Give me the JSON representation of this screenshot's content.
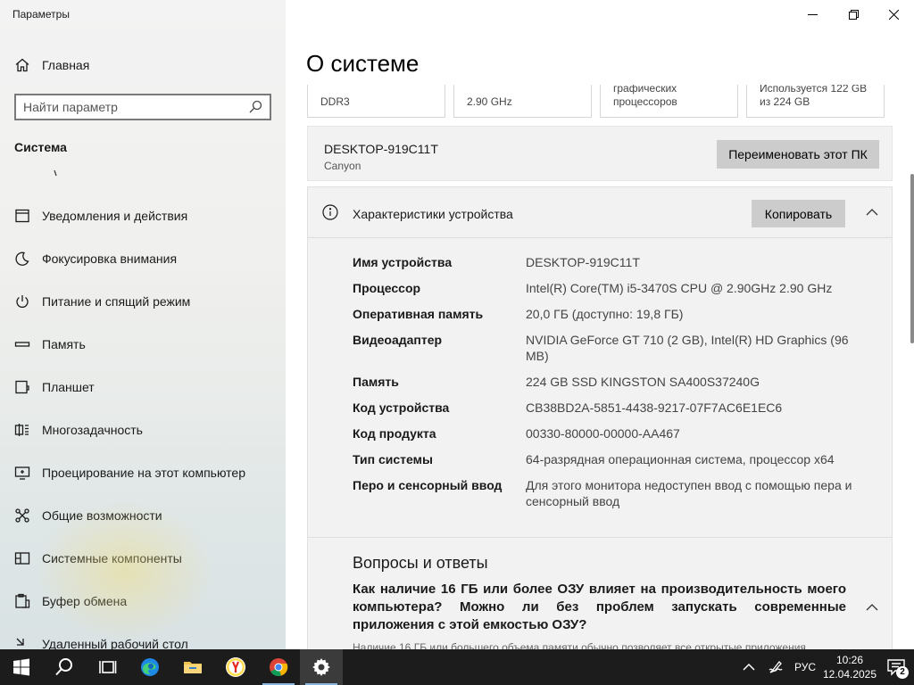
{
  "window": {
    "app_title": "Параметры"
  },
  "sidebar": {
    "home_label": "Главная",
    "search_placeholder": "Найти параметр",
    "section_title": "Система",
    "items": [
      {
        "label": "Уведомления и действия",
        "icon": "notification-icon"
      },
      {
        "label": "Фокусировка внимания",
        "icon": "moon-icon"
      },
      {
        "label": "Питание и спящий режим",
        "icon": "power-icon"
      },
      {
        "label": "Память",
        "icon": "storage-icon"
      },
      {
        "label": "Планшет",
        "icon": "tablet-icon"
      },
      {
        "label": "Многозадачность",
        "icon": "multitasking-icon"
      },
      {
        "label": "Проецирование на этот компьютер",
        "icon": "projection-icon"
      },
      {
        "label": "Общие возможности",
        "icon": "shared-experiences-icon"
      },
      {
        "label": "Системные компоненты",
        "icon": "system-components-icon"
      },
      {
        "label": "Буфер обмена",
        "icon": "clipboard-icon"
      },
      {
        "label": "Удаленный рабочий стол",
        "icon": "remote-desktop-icon"
      }
    ]
  },
  "main": {
    "page_title": "О системе",
    "spec_cards": [
      {
        "text": "DDR3"
      },
      {
        "text": "2.90 GHz"
      },
      {
        "text": "графических процессоров"
      },
      {
        "text": "Используется 122 GB из 224 GB"
      }
    ],
    "pc": {
      "name": "DESKTOP-919C11T",
      "subtitle": "Canyon",
      "rename_label": "Переименовать этот ПК"
    },
    "device_specs": {
      "title": "Характеристики устройства",
      "copy_label": "Копировать",
      "rows": [
        {
          "key": "Имя устройства",
          "value": "DESKTOP-919C11T"
        },
        {
          "key": "Процессор",
          "value": "Intel(R) Core(TM) i5-3470S CPU @ 2.90GHz   2.90 GHz"
        },
        {
          "key": "Оперативная память",
          "value": "20,0 ГБ (доступно: 19,8 ГБ)"
        },
        {
          "key": "Видеоадаптер",
          "value": "NVIDIA GeForce GT 710 (2 GB), Intel(R) HD Graphics (96 MB)"
        },
        {
          "key": "Память",
          "value": "224 GB SSD KINGSTON SA400S37240G"
        },
        {
          "key": "Код устройства",
          "value": "CB38BD2A-5851-4438-9217-07F7AC6E1EC6"
        },
        {
          "key": "Код продукта",
          "value": "00330-80000-00000-AA467"
        },
        {
          "key": "Тип системы",
          "value": "64-разрядная операционная система, процессор x64"
        },
        {
          "key": "Перо и сенсорный ввод",
          "value": "Для этого монитора недоступен ввод с помощью пера и сенсорный ввод"
        }
      ]
    },
    "faq": {
      "title": "Вопросы и ответы",
      "question": "Как наличие 16 ГБ или более ОЗУ влияет на производительность моего компьютера? Можно ли без проблем запускать современные приложения с этой емкостью ОЗУ?",
      "answer_partial": "Наличие 16 ГБ или большего объема памяти обычно позволяет все открытые приложения"
    }
  },
  "taskbar": {
    "apps": [
      {
        "name": "start-button",
        "icon": "windows-icon"
      },
      {
        "name": "search-button",
        "icon": "search-icon"
      },
      {
        "name": "task-view-button",
        "icon": "task-view-icon"
      },
      {
        "name": "edge-button",
        "icon": "edge-icon"
      },
      {
        "name": "file-explorer-button",
        "icon": "folder-icon"
      },
      {
        "name": "yandex-browser-button",
        "icon": "yandex-icon"
      },
      {
        "name": "chrome-button",
        "icon": "chrome-icon"
      },
      {
        "name": "settings-button",
        "icon": "gear-icon"
      }
    ],
    "language": "РУС",
    "time": "10:26",
    "date": "12.04.2025",
    "notification_count": "2"
  },
  "colors": {
    "button_bg": "#cccccc",
    "panel_bg": "#f2f2f2",
    "taskbar_bg": "#1c1c1c"
  }
}
